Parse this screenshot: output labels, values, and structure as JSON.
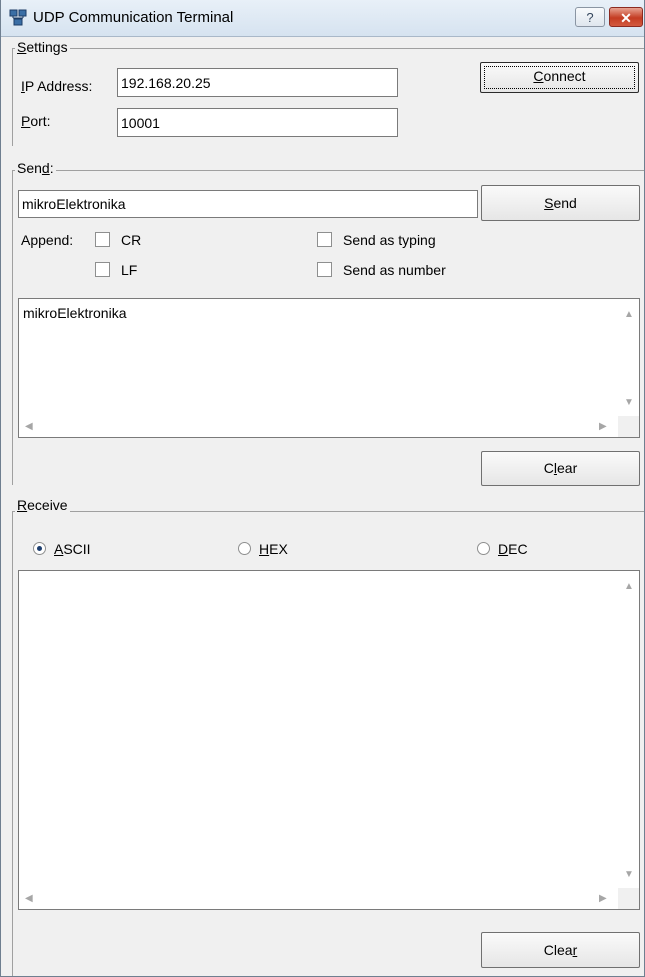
{
  "window": {
    "title": "UDP Communication Terminal",
    "help_label": "?",
    "close_label": "✕"
  },
  "settings": {
    "group_label": "Settings",
    "ip_label": "IP Address:",
    "ip_value": "192.168.20.25",
    "port_label": "Port:",
    "port_value": "10001",
    "connect_label": "Connect"
  },
  "send": {
    "group_label": "Send:",
    "input_value": "mikroElektronika",
    "send_label": "Send",
    "append_label": "Append:",
    "cr_label": "CR",
    "lf_label": "LF",
    "send_as_typing_label": "Send as typing",
    "send_as_number_label": "Send as number",
    "log_text": "mikroElektronika",
    "clear_label": "Clear"
  },
  "receive": {
    "group_label": "Receive",
    "ascii_label": "ASCII",
    "hex_label": "HEX",
    "dec_label": "DEC",
    "selected_format": "ASCII",
    "log_text": "",
    "clear_label": "Clear"
  },
  "icons": {
    "scroll_up": "scroll-up-arrow",
    "scroll_down": "scroll-down-arrow",
    "scroll_left": "scroll-left-arrow",
    "scroll_right": "scroll-right-arrow"
  },
  "colors": {
    "window_bg": "#f0f0f0",
    "close_button": "#c43c22",
    "titlebar": "#d6e3f0"
  }
}
